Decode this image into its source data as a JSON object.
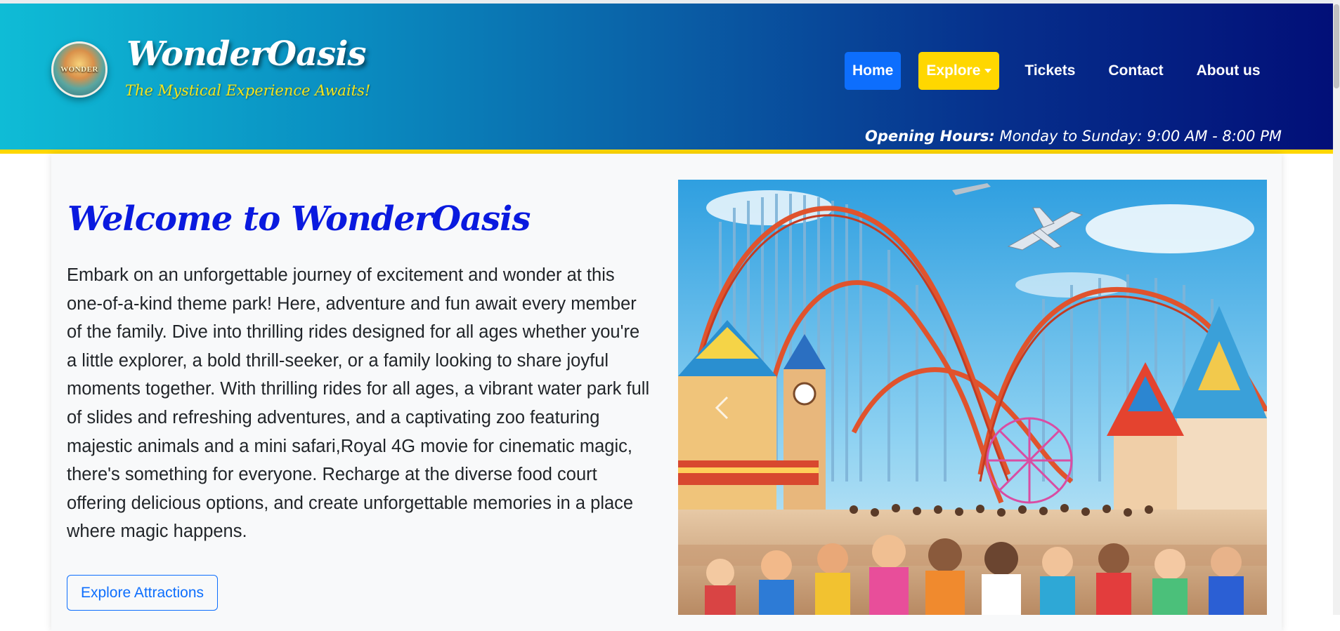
{
  "brand": {
    "logo_text": "WONDER",
    "name": "WonderOasis",
    "tagline": "The Mystical Experience Awaits!"
  },
  "nav": {
    "home": "Home",
    "explore": "Explore",
    "tickets": "Tickets",
    "contact": "Contact",
    "about": "About us"
  },
  "hours": {
    "label": "Opening Hours:",
    "value": "Monday to Sunday: 9:00 AM - 8:00 PM"
  },
  "main": {
    "title": "Welcome to WonderOasis",
    "description": "Embark on an unforgettable journey of excitement and wonder at this one-of-a-kind theme park! Here, adventure and fun await every member of the family. Dive into thrilling rides designed for all ages whether you're a little explorer, a bold thrill-seeker, or a family looking to share joyful moments together. With thrilling rides for all ages, a vibrant water park full of slides and refreshing adventures, and a captivating zoo featuring majestic animals and a mini safari,Royal 4G movie for cinematic magic, there's something for everyone. Recharge at the diverse food court offering delicious options, and create unforgettable memories in a place where magic happens.",
    "button": "Explore Attractions"
  },
  "colors": {
    "header_start": "#0fbcd6",
    "header_end": "#020f78",
    "accent_yellow": "#ffd700",
    "primary_blue": "#0d6efd",
    "title_blue": "#0a1adf"
  }
}
